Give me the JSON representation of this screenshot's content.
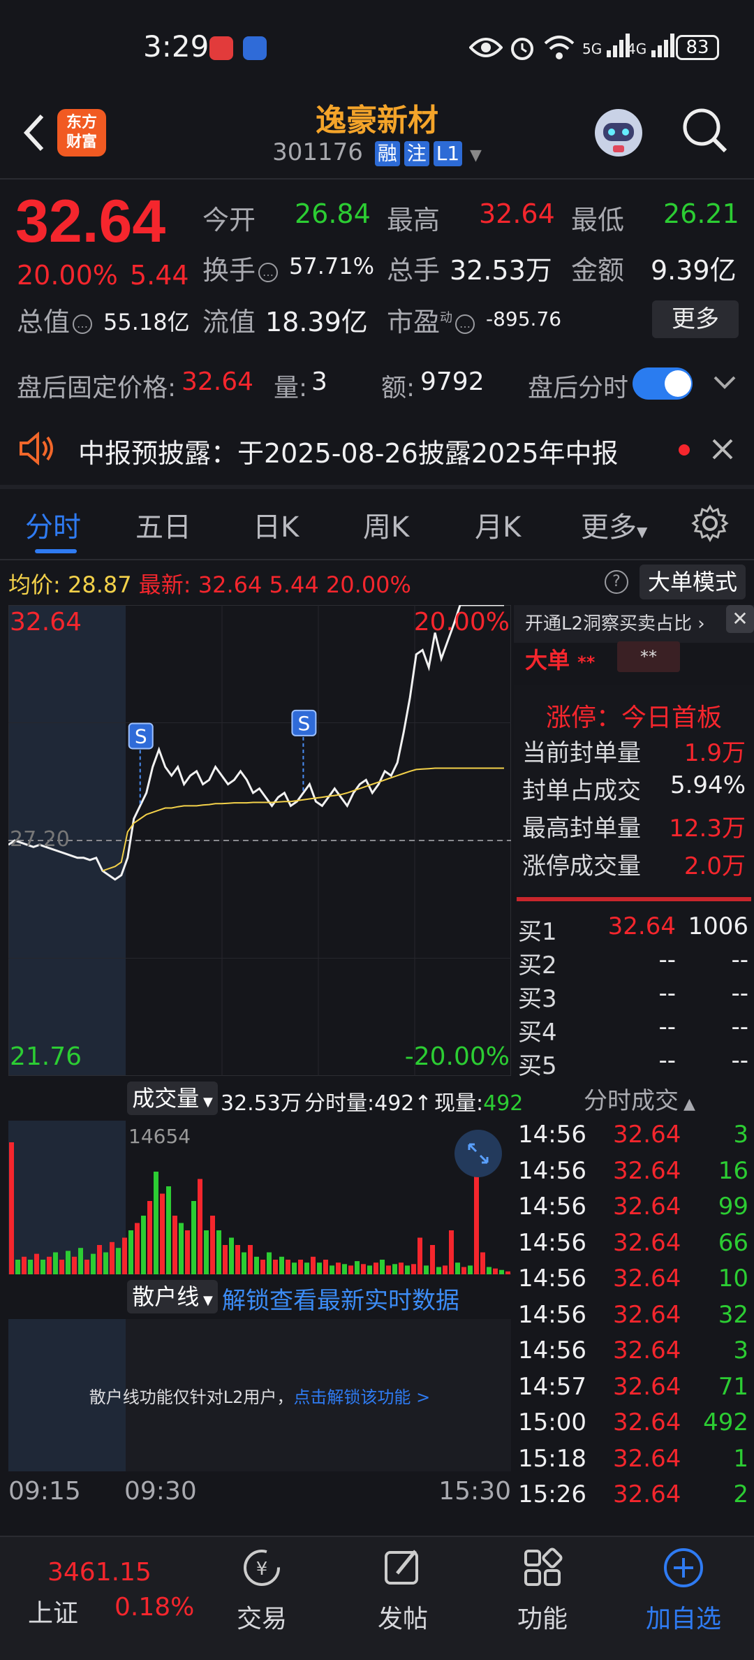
{
  "status_bar": {
    "time": "3:29",
    "battery": "83",
    "network_labels": [
      "5G",
      "4G"
    ]
  },
  "header": {
    "app_logo": [
      "东方",
      "财富"
    ],
    "stock_name": "逸豪新材",
    "stock_code": "301176",
    "tags": [
      "融",
      "注",
      "L1"
    ]
  },
  "quote": {
    "price": "32.64",
    "change_pct": "20.00%",
    "change_abs": "5.44",
    "rows": [
      [
        {
          "label": "今开",
          "value": "26.84",
          "color": "green"
        },
        {
          "label": "最高",
          "value": "32.64",
          "color": "red"
        },
        {
          "label": "最低",
          "value": "26.21",
          "color": "green"
        }
      ],
      [
        {
          "label": "换手",
          "value": "57.71%",
          "color": "white"
        },
        {
          "label": "总手",
          "value": "32.53万",
          "color": "white"
        },
        {
          "label": "金额",
          "value": "9.39亿",
          "color": "white"
        }
      ],
      [
        {
          "label": "总值",
          "value": "55.18亿",
          "color": "white"
        },
        {
          "label": "流值",
          "value": "18.39亿",
          "color": "white"
        },
        {
          "label": "市盈",
          "label_sup": "动",
          "value": "-895.76",
          "color": "white"
        }
      ]
    ],
    "more_button": "更多"
  },
  "after_hours": {
    "price_label": "盘后固定价格:",
    "price": "32.64",
    "vol_label": "量:",
    "vol": "3",
    "amt_label": "额:",
    "amt": "9792",
    "timeshare_label": "盘后分时",
    "toggle_on": true
  },
  "notice": {
    "text": "中报预披露：于2025-08-26披露2025年中报"
  },
  "tabs": [
    {
      "label": "分时",
      "active": true
    },
    {
      "label": "五日",
      "active": false
    },
    {
      "label": "日K",
      "active": false
    },
    {
      "label": "周K",
      "active": false
    },
    {
      "label": "月K",
      "active": false
    },
    {
      "label": "更多",
      "active": false
    }
  ],
  "chart_info": {
    "avg_label": "均价:",
    "avg_value": "28.87",
    "latest_label": "最新:",
    "latest_value": "32.64",
    "latest_chg": "5.44",
    "latest_pct": "20.00%",
    "big_order_button": "大单模式"
  },
  "chart_data": {
    "type": "line",
    "y_top_label": "32.64",
    "y_bottom_label": "21.76",
    "pct_top_label": "20.00%",
    "pct_bottom_label": "-20.00%",
    "prev_close_label": "27.20",
    "ylim": [
      21.76,
      32.64
    ],
    "prev_close": 27.2,
    "markers": [
      "S",
      "S"
    ],
    "x_labels": [
      "09:15",
      "09:30",
      "15:30"
    ],
    "series": [
      {
        "name": "最新",
        "values": [
          27.1,
          27.2,
          27.15,
          27.1,
          27.05,
          27.1,
          27.05,
          27.0,
          26.95,
          26.9,
          26.85,
          26.8,
          26.8,
          26.75,
          26.8,
          26.5,
          26.4,
          26.3,
          26.4,
          26.8,
          27.7,
          28.0,
          28.3,
          28.9,
          29.3,
          28.9,
          28.7,
          28.9,
          28.5,
          28.7,
          28.8,
          28.5,
          28.6,
          28.9,
          28.7,
          28.5,
          28.6,
          28.8,
          28.6,
          28.3,
          28.4,
          28.2,
          28.0,
          28.2,
          28.3,
          28.0,
          28.1,
          28.3,
          28.5,
          28.1,
          28.0,
          28.2,
          28.4,
          28.2,
          28.0,
          28.3,
          28.5,
          28.6,
          28.3,
          28.5,
          28.8,
          28.7,
          29.0,
          29.7,
          30.5,
          31.5,
          31.6,
          31.2,
          32.0,
          31.4,
          31.8,
          32.2,
          32.64,
          32.64,
          32.64,
          32.64,
          32.64,
          32.64,
          32.64,
          32.64
        ]
      },
      {
        "name": "均价",
        "values": [
          null,
          null,
          null,
          null,
          null,
          null,
          null,
          null,
          null,
          null,
          null,
          null,
          null,
          null,
          null,
          26.5,
          26.55,
          26.6,
          26.7,
          27.4,
          27.6,
          27.7,
          27.8,
          27.85,
          27.9,
          27.95,
          27.95,
          27.98,
          28.0,
          28.0,
          28.0,
          28.02,
          28.03,
          28.05,
          28.05,
          28.06,
          28.07,
          28.07,
          28.07,
          28.08,
          28.08,
          28.08,
          28.08,
          28.09,
          28.1,
          28.1,
          28.12,
          28.14,
          28.16,
          28.18,
          28.2,
          28.22,
          28.24,
          28.26,
          28.3,
          28.35,
          28.4,
          28.45,
          28.5,
          28.55,
          28.6,
          28.65,
          28.7,
          28.75,
          28.8,
          28.84,
          28.85,
          28.86,
          28.87,
          28.87,
          28.87,
          28.87,
          28.87,
          28.87,
          28.87,
          28.87,
          28.87,
          28.87,
          28.87,
          28.87
        ]
      }
    ]
  },
  "right_panel": {
    "l2_link": "开通L2洞察买卖占比",
    "big_order_label": "大单",
    "big_order_masked": "**",
    "limit_title": "涨停：今日首板",
    "stats": [
      {
        "label": "当前封单量",
        "value": "1.9万",
        "color": "red"
      },
      {
        "label": "封单占成交",
        "value": "5.94%",
        "color": "white"
      },
      {
        "label": "最高封单量",
        "value": "12.3万",
        "color": "red"
      },
      {
        "label": "涨停成交量",
        "value": "2.0万",
        "color": "red"
      }
    ],
    "bids": [
      {
        "label": "买1",
        "price": "32.64",
        "vol": "1006"
      },
      {
        "label": "买2",
        "price": "--",
        "vol": "--"
      },
      {
        "label": "买3",
        "price": "--",
        "vol": "--"
      },
      {
        "label": "买4",
        "price": "--",
        "vol": "--"
      },
      {
        "label": "买5",
        "price": "--",
        "vol": "--"
      }
    ],
    "ticks_title": "分时成交",
    "ticks": [
      {
        "time": "14:56",
        "price": "32.64",
        "vol": "3"
      },
      {
        "time": "14:56",
        "price": "32.64",
        "vol": "16"
      },
      {
        "time": "14:56",
        "price": "32.64",
        "vol": "99"
      },
      {
        "time": "14:56",
        "price": "32.64",
        "vol": "66"
      },
      {
        "time": "14:56",
        "price": "32.64",
        "vol": "10"
      },
      {
        "time": "14:56",
        "price": "32.64",
        "vol": "32"
      },
      {
        "time": "14:56",
        "price": "32.64",
        "vol": "3"
      },
      {
        "time": "14:57",
        "price": "32.64",
        "vol": "71"
      },
      {
        "time": "15:00",
        "price": "32.64",
        "vol": "492"
      },
      {
        "time": "15:18",
        "price": "32.64",
        "vol": "1"
      },
      {
        "time": "15:26",
        "price": "32.64",
        "vol": "2"
      }
    ]
  },
  "volume": {
    "dropdown": "成交量",
    "total": "32.53万",
    "per_min_label": "分时量:",
    "per_min": "492",
    "cur_label": "现量:",
    "cur": "492",
    "max_label": "14654",
    "bars": [
      0.9,
      0.1,
      0.12,
      0.1,
      0.14,
      0.1,
      0.12,
      0.15,
      0.1,
      0.16,
      0.12,
      0.18,
      0.1,
      0.14,
      0.2,
      0.15,
      0.22,
      0.18,
      0.25,
      0.3,
      0.35,
      0.4,
      0.5,
      0.7,
      0.55,
      0.6,
      0.4,
      0.35,
      0.3,
      0.5,
      0.65,
      0.3,
      0.4,
      0.3,
      0.2,
      0.25,
      0.2,
      0.15,
      0.2,
      0.12,
      0.1,
      0.15,
      0.1,
      0.12,
      0.1,
      0.08,
      0.1,
      0.08,
      0.12,
      0.08,
      0.1,
      0.06,
      0.08,
      0.07,
      0.06,
      0.09,
      0.07,
      0.06,
      0.08,
      0.1,
      0.06,
      0.07,
      0.08,
      0.06,
      0.07,
      0.25,
      0.06,
      0.2,
      0.05,
      0.06,
      0.3,
      0.08,
      0.05,
      0.06,
      0.95,
      0.15,
      0.05,
      0.04,
      0.03,
      0.02
    ],
    "bar_colors": [
      "red",
      "green",
      "red",
      "green",
      "red",
      "green",
      "red",
      "green",
      "red",
      "green",
      "red",
      "green",
      "red",
      "green",
      "red",
      "green",
      "red",
      "green",
      "red",
      "green",
      "red",
      "green",
      "red",
      "green",
      "red",
      "green",
      "red",
      "green",
      "red",
      "green",
      "red",
      "green",
      "red",
      "green",
      "red",
      "green",
      "red",
      "green",
      "red",
      "green",
      "red",
      "green",
      "red",
      "green",
      "red",
      "green",
      "red",
      "green",
      "red",
      "green",
      "red",
      "green",
      "red",
      "green",
      "red",
      "green",
      "red",
      "green",
      "red",
      "green",
      "red",
      "green",
      "red",
      "green",
      "red",
      "red",
      "green",
      "red",
      "green",
      "red",
      "red",
      "green",
      "red",
      "green",
      "red",
      "red",
      "green",
      "red",
      "green",
      "red"
    ]
  },
  "sanhu": {
    "dropdown": "散户线",
    "link": "解锁查看最新实时数据",
    "message": "散户线功能仅针对L2用户，",
    "message_link": "点击解锁该功能 >"
  },
  "bottom_nav": {
    "index_value": "3461.15",
    "index_name": "上证",
    "index_pct": "0.18%",
    "items": [
      {
        "label": "交易",
        "icon": "trade-icon"
      },
      {
        "label": "发帖",
        "icon": "post-icon"
      },
      {
        "label": "功能",
        "icon": "functions-icon"
      },
      {
        "label": "加自选",
        "icon": "add-watchlist-icon"
      }
    ]
  }
}
